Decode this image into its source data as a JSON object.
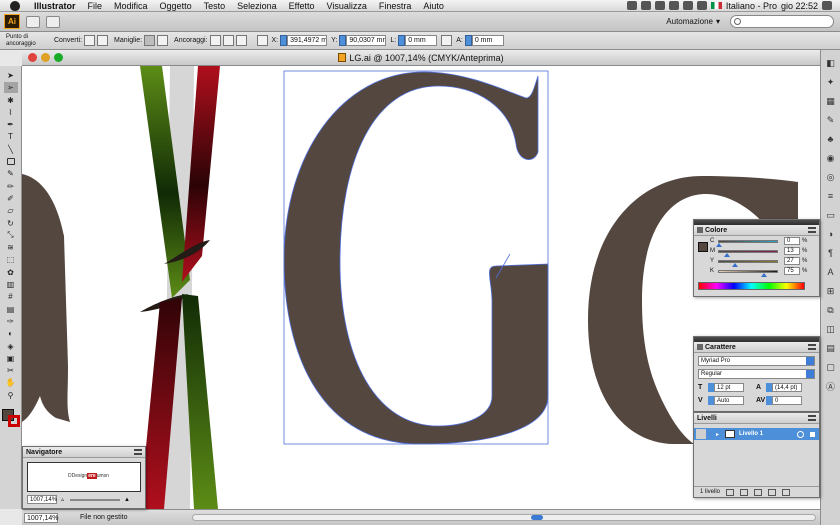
{
  "menubar": {
    "app_name": "Illustrator",
    "items": [
      "File",
      "Modifica",
      "Oggetto",
      "Testo",
      "Seleziona",
      "Effetto",
      "Visualizza",
      "Finestra",
      "Aiuto"
    ],
    "language": "Italiano - Pro",
    "clock": "gio 22:52"
  },
  "appbar": {
    "logo": "Ai",
    "workspace": "Automazione"
  },
  "control": {
    "anchor_point": "Punto di ancoraggio",
    "convert_label": "Converti:",
    "handles_label": "Maniglie:",
    "anchors_label": "Ancoraggi:",
    "x_label": "X:",
    "x_value": "391,4972 m",
    "y_label": "Y:",
    "y_value": "90,0307 mm",
    "l_label": "L:",
    "l_value": "0 mm",
    "a_label": "A:",
    "a_value": "0 mm"
  },
  "document": {
    "title": "LG.ai @ 1007,14% (CMYK/Anteprima)"
  },
  "status": {
    "zoom": "1007,14%",
    "text": "File non gestito"
  },
  "colore": {
    "title": "Colore",
    "channels": [
      {
        "label": "C",
        "value": "0"
      },
      {
        "label": "M",
        "value": "13"
      },
      {
        "label": "Y",
        "value": "27"
      },
      {
        "label": "K",
        "value": "75"
      }
    ],
    "pct": "%"
  },
  "carattere": {
    "title": "Carattere",
    "font": "Myriad Pro",
    "style": "Regular",
    "size": "12 pt",
    "leading": "(14,4 pt)",
    "kerning": "Auto",
    "tracking": "0"
  },
  "livelli": {
    "title": "Livelli",
    "layer_name": "Livello 1",
    "count": "1 livello"
  },
  "navigator": {
    "title": "Navigatore",
    "zoom": "1007,14%",
    "preview_text_pre": "DDesign",
    "preview_text_highlight": "ere",
    "preview_text_post": "umsn"
  },
  "colors": {
    "glyph": "#544740",
    "red_ribbon": "#b00f1d",
    "green_ribbon": "#5a8a17",
    "selection": "#4f6fd8"
  }
}
